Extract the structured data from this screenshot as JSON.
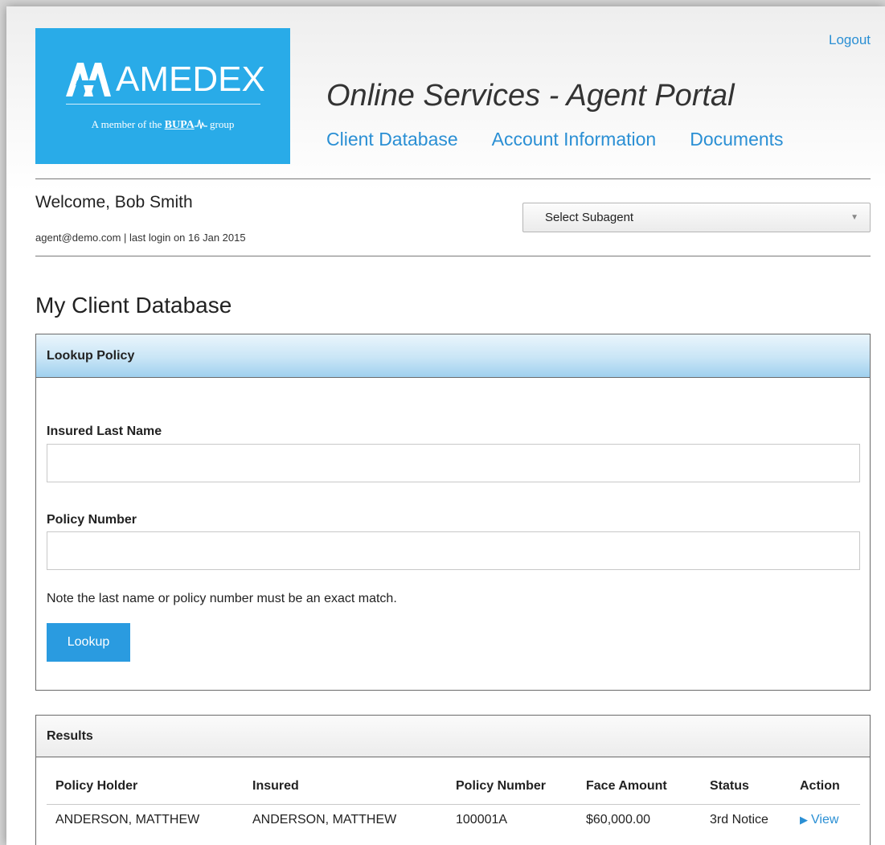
{
  "brand": {
    "name": "AMEDEX",
    "tagline_prefix": "A member of the",
    "tagline_brand": "BUPA",
    "tagline_suffix": "group",
    "color": "#29abe8"
  },
  "header": {
    "logout_label": "Logout",
    "portal_title": "Online Services - Agent Portal",
    "nav": [
      "Client Database",
      "Account Information",
      "Documents"
    ]
  },
  "user": {
    "welcome": "Welcome, Bob Smith",
    "login_line": "agent@demo.com | last login on 16 Jan 2015"
  },
  "subagent_select": {
    "selected": "Select Subagent",
    "icon": "chevron-down-icon"
  },
  "section_title": "My Client Database",
  "lookup": {
    "heading": "Lookup Policy",
    "last_name_label": "Insured Last Name",
    "last_name_value": "",
    "policy_number_label": "Policy Number",
    "policy_number_value": "",
    "note": "Note the last name or policy number must be an exact match.",
    "button_label": "Lookup"
  },
  "results": {
    "heading": "Results",
    "columns": [
      "Policy Holder",
      "Insured",
      "Policy Number",
      "Face Amount",
      "Status",
      "Action"
    ],
    "rows": [
      {
        "policy_holder": "ANDERSON, MATTHEW",
        "insured": "ANDERSON, MATTHEW",
        "policy_number": "100001A",
        "face_amount": "$60,000.00",
        "status": "3rd Notice",
        "action": "View"
      }
    ]
  },
  "colors": {
    "link": "#2a8fd4",
    "button": "#2a9be0",
    "panel_header_blue": "#9fd0ee"
  }
}
